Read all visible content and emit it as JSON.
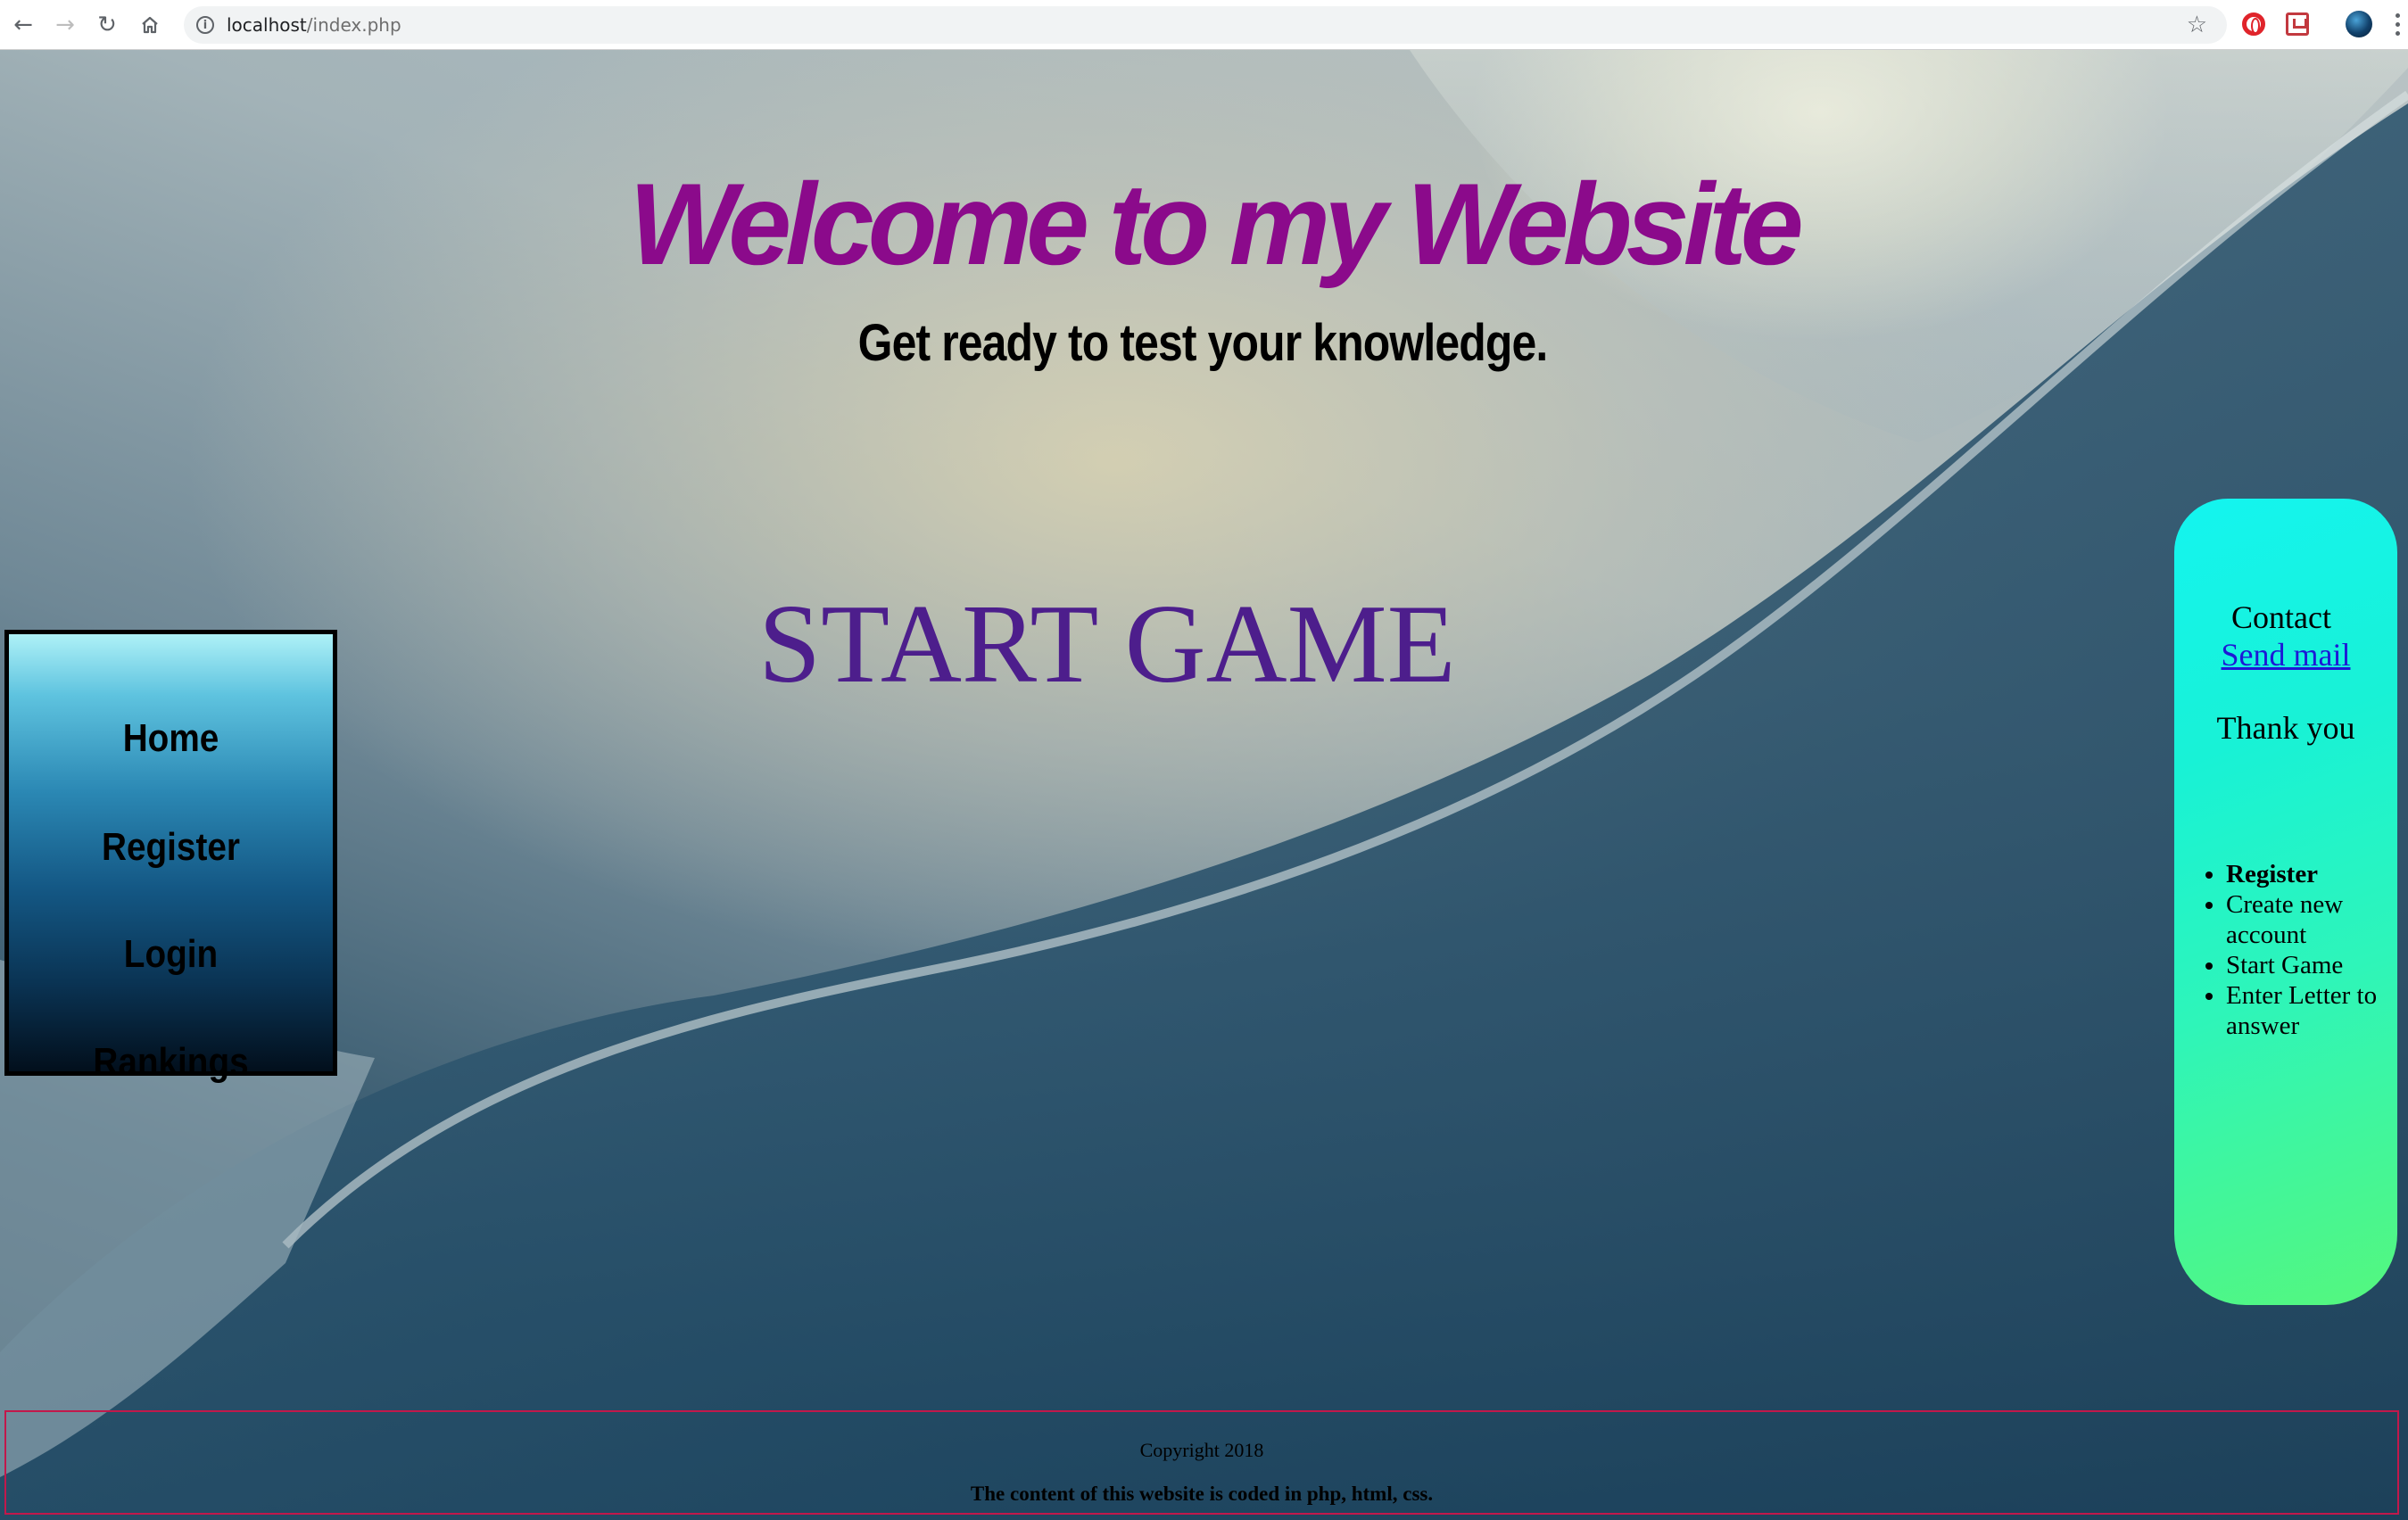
{
  "browser": {
    "url_host": "localhost",
    "url_path": "/index.php",
    "icons": [
      "back-arrow-icon",
      "forward-arrow-icon",
      "reload-icon",
      "home-icon",
      "info-icon",
      "star-icon",
      "opera-icon",
      "pocket-icon",
      "profile-avatar",
      "menu-kebab-icon"
    ]
  },
  "header": {
    "title": "Welcome to my Website",
    "subtitle": "Get ready to test your knowledge."
  },
  "main": {
    "start_game_label": "START GAME"
  },
  "sidenav": {
    "items": [
      {
        "label": "Home"
      },
      {
        "label": "Register"
      },
      {
        "label": "Login"
      },
      {
        "label": "Rankings"
      }
    ]
  },
  "contact": {
    "label": "Contact",
    "mail_link": "Send mail",
    "thanks": "Thank you",
    "steps": [
      "Register",
      "Create new account",
      "Start Game",
      "Enter Letter to answer"
    ]
  },
  "footer": {
    "copyright": "Copyright 2018",
    "description": "The content of this website is coded in php, html, css."
  },
  "colors": {
    "title": "#8b0a8b",
    "start_game": "#4d1e8c",
    "link": "#1d19d6",
    "footer_border": "#c2184b",
    "panel_gradient_start": "#14f4f0",
    "panel_gradient_end": "#55f77d"
  }
}
